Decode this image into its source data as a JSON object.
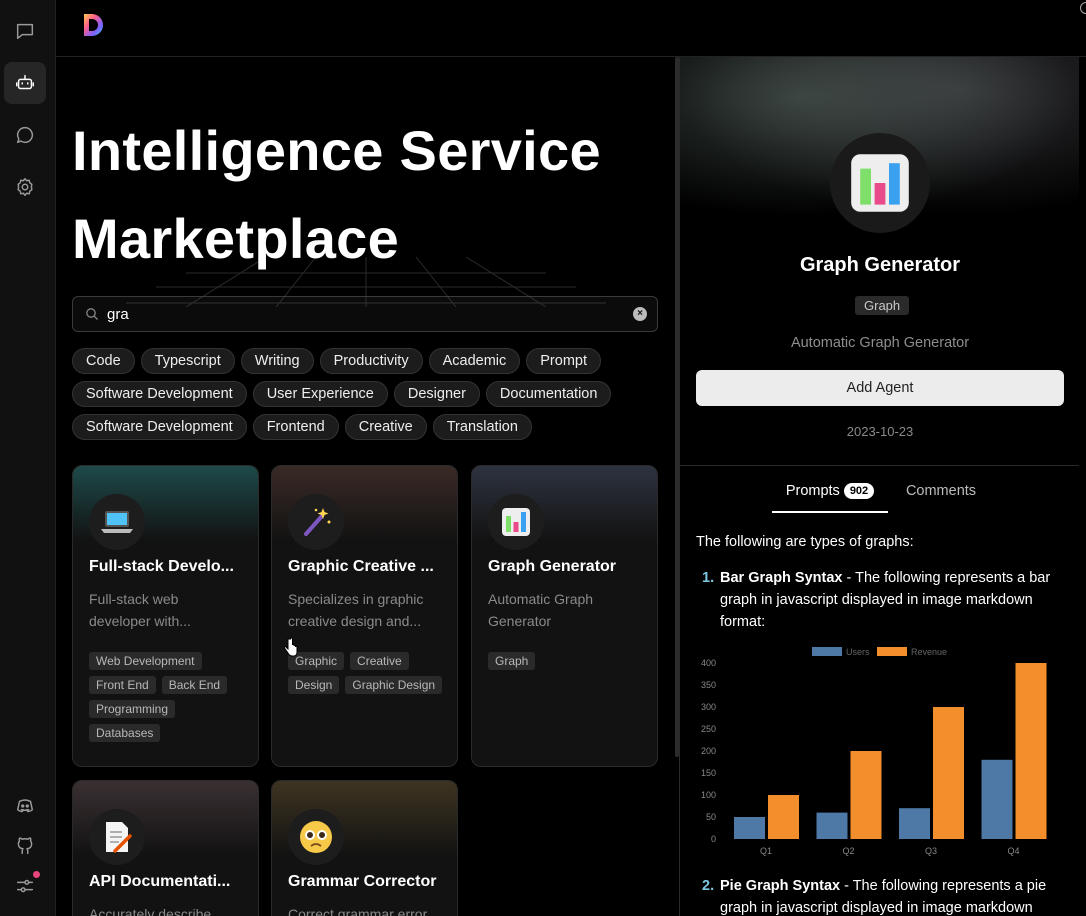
{
  "nav": {
    "items": [
      "chat",
      "agents",
      "discover",
      "settings"
    ],
    "bottom": [
      "discord",
      "github",
      "preferences"
    ]
  },
  "hero": {
    "line1": "Intelligence Service",
    "line2": "Marketplace"
  },
  "search": {
    "value": "gra",
    "placeholder": ""
  },
  "tags": [
    [
      "Code",
      "Typescript",
      "Writing",
      "Productivity",
      "Academic",
      "Prompt"
    ],
    [
      "Software Development",
      "User Experience",
      "Designer",
      "Documentation"
    ],
    [
      "Software Development",
      "Frontend",
      "Creative",
      "Translation"
    ]
  ],
  "cards": [
    {
      "title": "Full-stack Develo...",
      "desc": "Full-stack web developer with...",
      "avatar": "laptop-icon",
      "tags": [
        "Web Development",
        "Front End",
        "Back End",
        "Programming",
        "Databases"
      ]
    },
    {
      "title": "Graphic Creative ...",
      "desc": "Specializes in graphic creative design and...",
      "avatar": "magic-wand-icon",
      "tags": [
        "Graphic",
        "Creative",
        "Design",
        "Graphic Design"
      ]
    },
    {
      "title": "Graph Generator",
      "desc": "Automatic Graph Generator",
      "avatar": "bar-chart-icon",
      "tags": [
        "Graph"
      ]
    },
    {
      "title": "API Documentati...",
      "desc": "Accurately describe",
      "avatar": "memo-icon",
      "tags": []
    },
    {
      "title": "Grammar Corrector",
      "desc": "Correct grammar error",
      "avatar": "pleading-face-icon",
      "tags": []
    }
  ],
  "panel": {
    "title": "Graph Generator",
    "tag": "Graph",
    "desc": "Automatic Graph Generator",
    "add_button": "Add Agent",
    "date": "2023-10-23",
    "tab_prompts": "Prompts",
    "prompt_count": "902",
    "tab_comments": "Comments",
    "intro": "The following are types of graphs:",
    "item1_num": "1.",
    "item1_bold": "Bar Graph Syntax",
    "item1_text": " - The following represents a bar graph in javascript displayed in image markdown format:",
    "item2_num": "2.",
    "item2_bold": "Pie Graph Syntax",
    "item2_text": " - The following represents a pie graph in javascript displayed in image markdown"
  },
  "chart_data": {
    "type": "bar",
    "categories": [
      "Q1",
      "Q2",
      "Q3",
      "Q4"
    ],
    "series": [
      {
        "name": "Users",
        "values": [
          50,
          60,
          70,
          180
        ],
        "color": "#4e79a7"
      },
      {
        "name": "Revenue",
        "values": [
          100,
          200,
          300,
          400
        ],
        "color": "#f28e2b"
      }
    ],
    "ylim": [
      0,
      400
    ],
    "yticks": [
      0,
      50,
      100,
      150,
      200,
      250,
      300,
      350,
      400
    ],
    "legend": "top-center",
    "grid": false
  }
}
